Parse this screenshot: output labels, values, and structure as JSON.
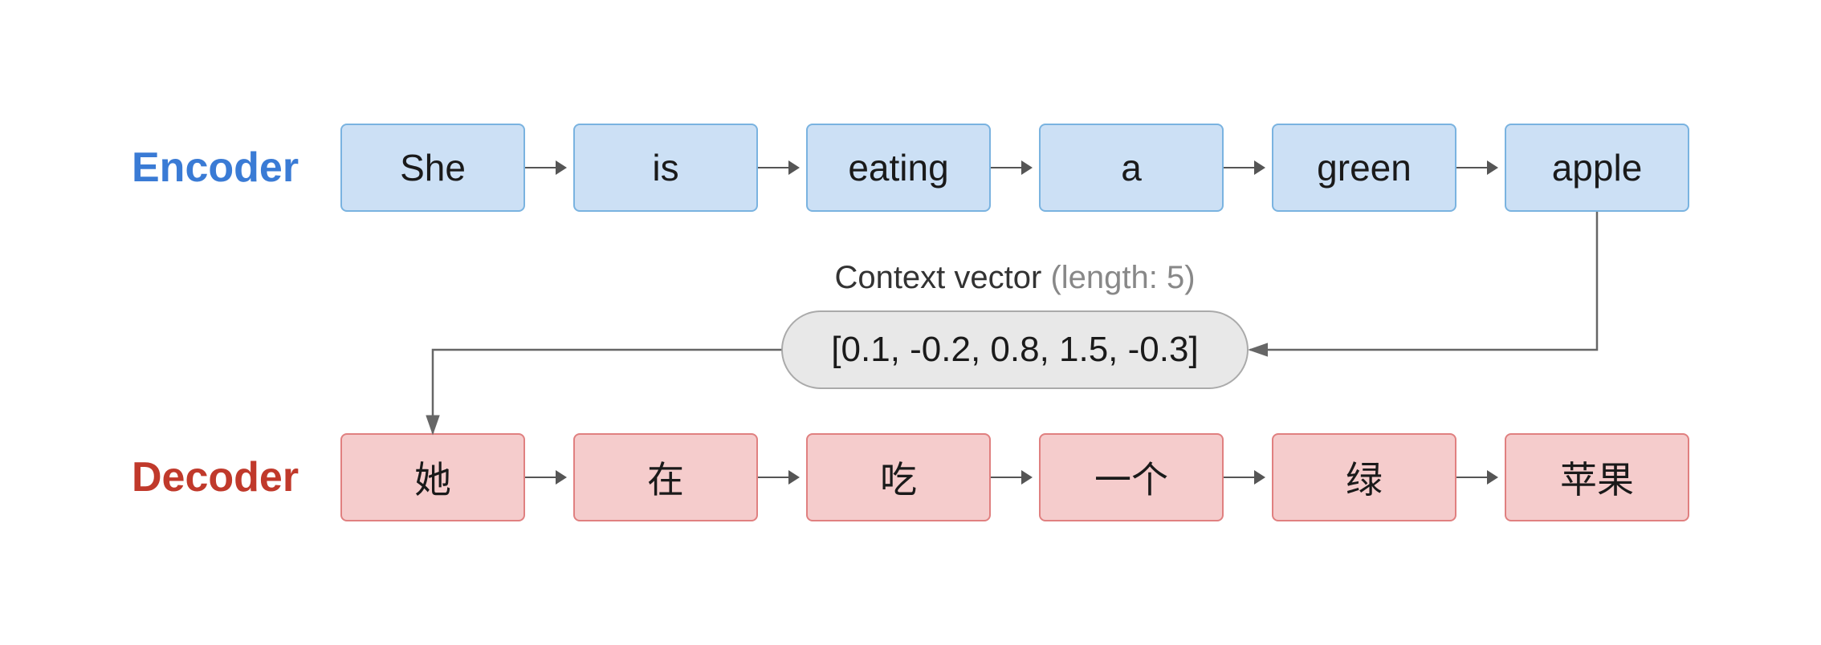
{
  "encoder": {
    "label": "Encoder",
    "words": [
      "She",
      "is",
      "eating",
      "a",
      "green",
      "apple"
    ]
  },
  "context": {
    "label": "Context vector",
    "length_label": "(length: 5)",
    "vector": "[0.1, -0.2, 0.8, 1.5, -0.3]"
  },
  "decoder": {
    "label": "Decoder",
    "words": [
      "她",
      "在",
      "吃",
      "一个",
      "绿",
      "苹果"
    ]
  },
  "colors": {
    "encoder_label": "#3a7bd5",
    "decoder_label": "#c0392b",
    "enc_box_bg": "#cce0f5",
    "enc_box_border": "#7ab3e0",
    "dec_box_bg": "#f5cccc",
    "dec_box_border": "#e08080",
    "arrow": "#555555"
  }
}
